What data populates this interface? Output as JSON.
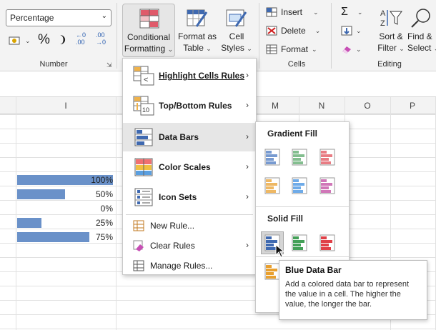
{
  "ribbon": {
    "number_format": "Percentage",
    "number_group_label": "Number",
    "cells_group_label": "Cells",
    "editing_group_label": "Editing",
    "conditional_formatting": [
      "Conditional",
      "Formatting"
    ],
    "format_as_table": [
      "Format as",
      "Table"
    ],
    "cell_styles": [
      "Cell",
      "Styles"
    ],
    "insert": "Insert",
    "delete": "Delete",
    "format": "Format",
    "sort_filter": [
      "Sort &",
      "Filter"
    ],
    "find_select": [
      "Find &",
      "Select"
    ],
    "percent_symbol": "%",
    "comma_symbol": "❩",
    "inc_decimal": [
      "←0",
      ".00"
    ],
    "dec_decimal": [
      ".00",
      "→0"
    ],
    "sum_symbol": "Σ"
  },
  "columns": [
    "I",
    "M",
    "N",
    "O",
    "P"
  ],
  "cells": [
    {
      "label": "100%",
      "fraction": 1.0
    },
    {
      "label": "50%",
      "fraction": 0.5
    },
    {
      "label": "0%",
      "fraction": 0.0
    },
    {
      "label": "25%",
      "fraction": 0.25
    },
    {
      "label": "75%",
      "fraction": 0.75
    }
  ],
  "cf_menu": {
    "highlight": "Highlight Cells Rules",
    "topbottom": "Top/Bottom Rules",
    "databars": "Data Bars",
    "colorscales": "Color Scales",
    "iconsets": "Icon Sets",
    "newrule": "New Rule...",
    "clearrules": "Clear Rules",
    "managerules": "Manage Rules...",
    "topbottom_icon_text": "10"
  },
  "databars_menu": {
    "gradient_heading": "Gradient Fill",
    "solid_heading": "Solid Fill",
    "gradient_colors": [
      "#4a78c0",
      "#5aa86a",
      "#e0505a",
      "#e8a030",
      "#3f8fe0",
      "#c04aa0"
    ],
    "solid_colors": [
      "#3f69b0",
      "#44a058",
      "#e04048",
      "#e8a030"
    ]
  },
  "tooltip": {
    "title": "Blue Data Bar",
    "body": "Add a colored data bar to represent the value in a cell. The higher the value, the longer the bar."
  }
}
